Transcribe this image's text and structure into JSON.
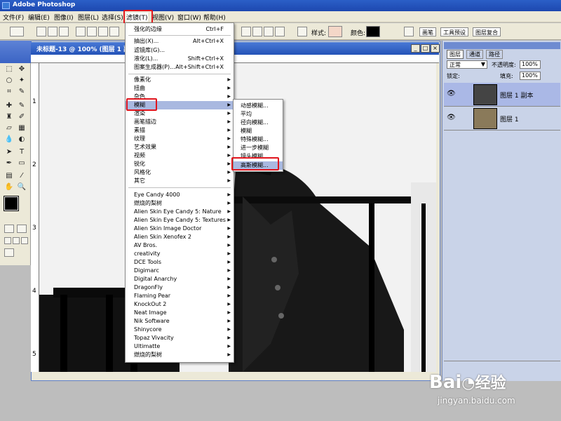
{
  "app": {
    "title": "Adobe Photoshop"
  },
  "menubar": {
    "items": [
      "文件(F)",
      "编辑(E)",
      "图像(I)",
      "图层(L)",
      "选择(S)",
      "滤镜(T)",
      "视图(V)",
      "窗口(W)",
      "帮助(H)"
    ],
    "active": "滤镜(T)"
  },
  "options_bar": {
    "style_label": "样式:",
    "color_label": "颜色:",
    "tabs": [
      "画笔",
      "工具预设",
      "图层复合"
    ]
  },
  "document": {
    "title": "未标题-13 @ 100% (图层 1 副本",
    "ruler_marks": [
      "1",
      "2",
      "3",
      "4",
      "5"
    ]
  },
  "filter_menu": {
    "top_items": [
      {
        "label": "强化的边缘",
        "shortcut": "Ctrl+F"
      },
      {
        "label": "抽出(X)...",
        "shortcut": "Alt+Ctrl+X"
      },
      {
        "label": "滤镜库(G)...",
        "shortcut": ""
      },
      {
        "label": "液化(L)...",
        "shortcut": "Shift+Ctrl+X"
      },
      {
        "label": "图案生成器(P)...",
        "shortcut": "Alt+Shift+Ctrl+X"
      }
    ],
    "group_items": [
      "像素化",
      "扭曲",
      "杂色",
      "模糊",
      "渲染",
      "画笔描边",
      "素描",
      "纹理",
      "艺术效果",
      "视频",
      "锐化",
      "风格化",
      "其它"
    ],
    "highlighted": "模糊",
    "plugin_items": [
      "Eye Candy 4000",
      "燃烧的梨树",
      "Alien Skin Eye Candy 5: Nature",
      "Alien Skin Eye Candy 5: Textures",
      "Alien Skin Image Doctor",
      "Alien Skin Xenofex 2",
      "AV Bros.",
      "creativity",
      "DCE Tools",
      "Digimarc",
      "Digital Anarchy",
      "DragonFly",
      "Flaming Pear",
      "KnockOut 2",
      "Neat Image",
      "Nik Software",
      "Shinycore",
      "Topaz Vivacity",
      "Ultimatte",
      "燃烧的梨树"
    ]
  },
  "blur_submenu": {
    "items": [
      "动感模糊...",
      "平均",
      "径向模糊...",
      "模糊",
      "特殊模糊...",
      "进一步模糊",
      "镜头模糊...",
      "高斯模糊..."
    ],
    "highlighted": "高斯模糊..."
  },
  "layers_panel": {
    "tabs": [
      "图层",
      "通道",
      "路径"
    ],
    "blend_mode": "正常",
    "opacity_label": "不透明度:",
    "opacity_value": "100%",
    "lock_label": "锁定:",
    "fill_label": "填充:",
    "fill_value": "100%",
    "layers": [
      {
        "name": "图层 1 副本",
        "selected": true
      },
      {
        "name": "图层 1",
        "selected": false
      }
    ]
  },
  "watermark": {
    "brand": "Bai",
    "brand2": "经验",
    "url": "jingyan.baidu.com"
  },
  "colors": {
    "highlight_red": "#e0161e",
    "menu_highlight": "#a9b8e0",
    "title_blue": "#2453b8"
  }
}
